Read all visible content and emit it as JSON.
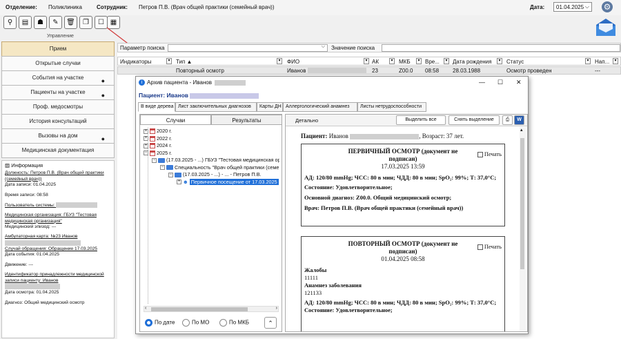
{
  "header": {
    "dept_label": "Отделение:",
    "dept_value": "Поликлиника",
    "staff_label": "Сотрудник:",
    "staff_value": "Петров П.В. (Врач общей практики (семейный врач))",
    "date_label": "Дата:",
    "date_value": "01.04.2025"
  },
  "toolbar": {
    "group_label": "Управление",
    "icons": [
      "user-search-icon",
      "document-icon",
      "users-icon",
      "edit-icon",
      "delete-icon",
      "copy-icon",
      "archive-icon",
      "patient-archive-icon"
    ]
  },
  "sidebar": {
    "items": [
      {
        "label": "Прием",
        "active": true,
        "dot": false
      },
      {
        "label": "Открытые случаи",
        "dot": false
      },
      {
        "label": "События на участке",
        "dot": true
      },
      {
        "label": "Пациенты на участке",
        "dot": true
      },
      {
        "label": "Проф. медосмотры",
        "dot": false
      },
      {
        "label": "История консультаций",
        "dot": false
      },
      {
        "label": "Вызовы на дом",
        "dot": true
      },
      {
        "label": "Медицинская документация",
        "dot": false
      }
    ]
  },
  "info": {
    "title": "Информация",
    "lines": [
      "Должность: Петров П.В. (Врач общей практики (семейный врач))",
      "Дата записи: 01.04.2025",
      "Время записи: 08:58",
      "Пользователь системы:",
      "Медицинская организация: ГБУЗ \"Тестовая медицинская организация\"",
      "Медицинский эпизод: ---",
      "Амбулаторная карта: №23 Иванов",
      "Случай обращения: Обращение 17.03.2025",
      "Дата события: 01.04.2025",
      "Движение: ---",
      "Идентификатор принадлежности медицинской записи пациенту: Иванов",
      "Дата осмотра: 01.04.2025",
      "Диагноз: Общий медицинский осмотр"
    ]
  },
  "grid": {
    "search_label": "Параметр поиска",
    "search_value_label": "Значение поиска",
    "columns": [
      "Индикаторы",
      "Тип ▲",
      "ФИО",
      "АК",
      "МКБ",
      "Вре...",
      "Дата рождения",
      "Статус",
      "Нап..."
    ],
    "row": [
      "",
      "Повторный осмотр",
      "Иванов",
      "23",
      "Z00.0",
      "08:58",
      "28.03.1988",
      "Осмотр проведен",
      "---"
    ]
  },
  "dialog": {
    "title": "Архив пациента - Иванов",
    "patient_label": "Пациент:",
    "patient_name": "Иванов",
    "tabs": [
      "В виде дерева",
      "Лист заключительных диагнозов",
      "Карты ДН",
      "Аллергологический анамнез",
      "Листы нетрудоспособности"
    ],
    "left_tabs": [
      "Случаи",
      "Результаты"
    ],
    "tree": [
      "2020 г.",
      "2022 г.",
      "2024 г.",
      "2025 г.",
      "(17.03.2025 - ...) ГБУЗ \"Тестовая медицинская ор",
      "Специальность \"Врач общей практики (семе",
      "(17.03.2025 - ...) - ... - Петров П.В.",
      "Первичное посещение от 17.03.2025"
    ],
    "radios": [
      "По дате",
      "По МО",
      "По МКБ"
    ],
    "right_tab": "Детально",
    "btn_select_all": "Выделить все",
    "btn_deselect": "Снять выделение",
    "doc": {
      "patient_prefix": "Пациент:",
      "patient_name": "Иванов",
      "age": ", Возраст: 37 лет.",
      "card1_title": "ПЕРВИЧНЫЙ ОСМОТР (документ не подписан)",
      "card1_date": "17.03.2025 13:59",
      "print": "Печать",
      "vitals": "АД: 120/80 mmHg; ЧСС: 80 в мин; ЧДД: 80 в мин; SpO₂: 99%; Т: 37,0°С;",
      "state": "Состояние: Удовлетворительное;",
      "diag": "Основной диагноз: Z00.0. Общий медицинский осмотр;",
      "doctor": "Врач: Петров П.В. (Врач общей практики (семейный врач))",
      "card2_title": "ПОВТОРНЫЙ ОСМОТР (документ не подписан)",
      "card2_date": "01.04.2025 08:58",
      "complaints_h": "Жалобы",
      "complaints": "11111",
      "anamnesis_h": "Анамнез заболевания",
      "anamnesis": "121133",
      "vitals2": "АД: 120/80 mmHg; ЧСС: 80 в мин; ЧДД: 80 в мин; SpO₂: 99%; Т: 37,0°С;",
      "state2": "Состояние: Удовлетворительное;"
    }
  },
  "colors": {
    "accent": "#1f6fd8",
    "active_nav": "#f5e7c4",
    "arrow": "#d23a3a"
  }
}
